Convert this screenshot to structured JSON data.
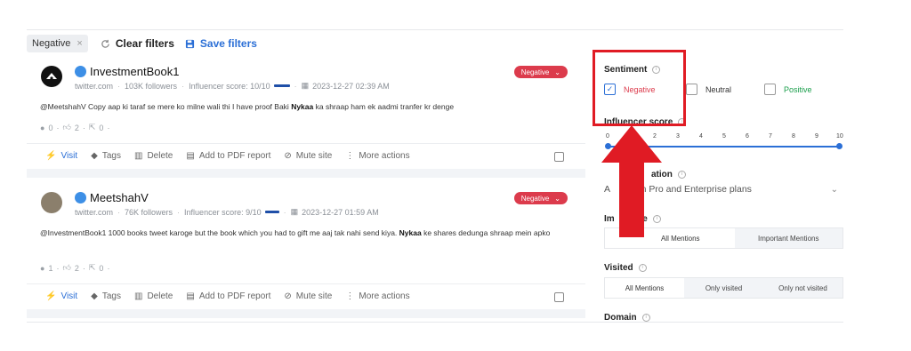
{
  "filter_bar": {
    "chip_label": "Negative",
    "chip_close": "×",
    "clear_label": "Clear filters",
    "save_label": "Save filters"
  },
  "posts": [
    {
      "author": "InvestmentBook1",
      "source": "twitter.com",
      "followers": "103K followers",
      "influencer": "Influencer score: 10/10",
      "influencer_level": 1.0,
      "date": "2023-12-27 02:39 AM",
      "sentiment": "Negative",
      "text_before": "@MeetshahV Copy aap ki taraf se mere ko milne wali thi I have proof Baki ",
      "text_bold": "Nykaa",
      "text_after": " ka shraap ham ek aadmi tranfer kr denge",
      "comments": "0",
      "likes": "2",
      "shares": "0"
    },
    {
      "author": "MeetshahV",
      "source": "twitter.com",
      "followers": "76K followers",
      "influencer": "Influencer score: 9/10",
      "influencer_level": 0.9,
      "date": "2023-12-27 01:59 AM",
      "sentiment": "Negative",
      "text_before": "@InvestmentBook1 1000 books tweet karoge but the book which you had to gift me aaj tak nahi send kiya. ",
      "text_bold": "Nykaa",
      "text_after": " ke shares dedunga shraap mein apko",
      "comments": "1",
      "likes": "2",
      "shares": "0"
    }
  ],
  "actions": {
    "visit": "Visit",
    "tags": "Tags",
    "delete": "Delete",
    "pdf": "Add to PDF report",
    "mute": "Mute site",
    "more": "More actions"
  },
  "sidebar": {
    "sentiment_title": "Sentiment",
    "sentiment_options": [
      "Negative",
      "Neutral",
      "Positive"
    ],
    "sentiment_colors": {
      "negative": "#dc3b4c",
      "neutral": "#333333",
      "positive": "#1a9e4b"
    },
    "influencer_title": "Influencer score",
    "influencer_ticks": [
      "0",
      "2",
      "3",
      "4",
      "5",
      "6",
      "7",
      "8",
      "9",
      "10"
    ],
    "influencer_range": [
      0,
      10
    ],
    "location_title": "ation",
    "location_value": "e on Pro and Enterprise plans",
    "location_prefix": "A",
    "importance_title": "Im",
    "importance_title_tail": "ce",
    "importance_options": [
      "All Mentions",
      "Important Mentions"
    ],
    "visited_title": "Visited",
    "visited_options": [
      "All Mentions",
      "Only visited",
      "Only not visited"
    ],
    "domain_title": "Domain"
  }
}
